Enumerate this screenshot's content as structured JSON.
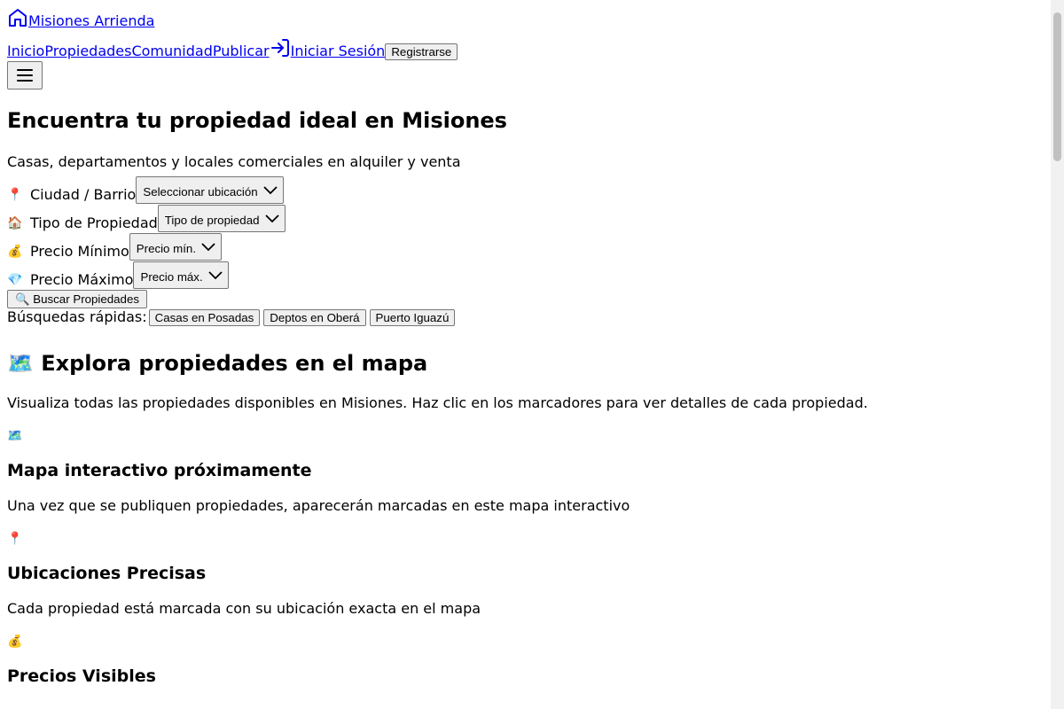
{
  "header": {
    "brand": "Misiones Arrienda",
    "nav": [
      "Inicio",
      "Propiedades",
      "Comunidad",
      "Publicar"
    ],
    "login": "Iniciar Sesión",
    "register": "Registrarse"
  },
  "hero": {
    "title": "Encuentra tu propiedad ideal en Misiones",
    "subtitle": "Casas, departamentos y locales comerciales en alquiler y venta"
  },
  "search": {
    "fields": [
      {
        "emoji": "📍",
        "label": "Ciudad / Barrio",
        "value": "Seleccionar ubicación"
      },
      {
        "emoji": "🏠",
        "label": "Tipo de Propiedad",
        "value": "Tipo de propiedad"
      },
      {
        "emoji": "💰",
        "label": "Precio Mínimo",
        "value": "Precio mín."
      },
      {
        "emoji": "💎",
        "label": "Precio Máximo",
        "value": "Precio máx."
      }
    ],
    "button": "🔍 Buscar Propiedades",
    "quick_label": "Búsquedas rápidas:",
    "quick": [
      "Casas en Posadas",
      "Deptos en Oberá",
      "Puerto Iguazú"
    ]
  },
  "map": {
    "title": "🗺️ Explora propiedades en el mapa",
    "description": "Visualiza todas las propiedades disponibles en Misiones. Haz clic en los marcadores para ver detalles de cada propiedad.",
    "placeholder_emoji": "🗺️",
    "placeholder_title": "Mapa interactivo próximamente",
    "placeholder_text": "Una vez que se publiquen propiedades, aparecerán marcadas en este mapa interactivo"
  },
  "features": [
    {
      "emoji": "📍",
      "title": "Ubicaciones Precisas",
      "text": "Cada propiedad está marcada con su ubicación exacta en el mapa"
    },
    {
      "emoji": "💰",
      "title": "Precios Visibles"
    }
  ]
}
